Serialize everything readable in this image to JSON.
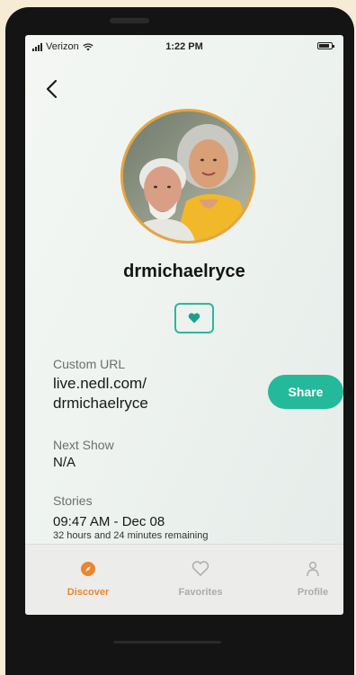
{
  "status_bar": {
    "carrier": "Verizon",
    "time": "1:22 PM"
  },
  "profile": {
    "username": "drmichaelryce"
  },
  "custom_url": {
    "label": "Custom URL",
    "value_line1": "live.nedl.com/",
    "value_line2": "drmichaelryce",
    "share_label": "Share"
  },
  "next_show": {
    "label": "Next Show",
    "value": "N/A"
  },
  "stories": {
    "label": "Stories",
    "date": "09:47 AM - Dec 08",
    "remaining": "32 hours and 24 minutes remaining"
  },
  "tab_bar": {
    "tabs": [
      {
        "label": "Discover",
        "icon": "compass-icon",
        "active": true
      },
      {
        "label": "Favorites",
        "icon": "heart-outline-icon",
        "active": false
      },
      {
        "label": "Profile",
        "icon": "person-icon",
        "active": false
      }
    ]
  },
  "colors": {
    "accent": "#24b99a",
    "active_tab": "#e8872f",
    "inactive_tab": "#a9adad",
    "avatar_ring": "#e8a43e"
  }
}
